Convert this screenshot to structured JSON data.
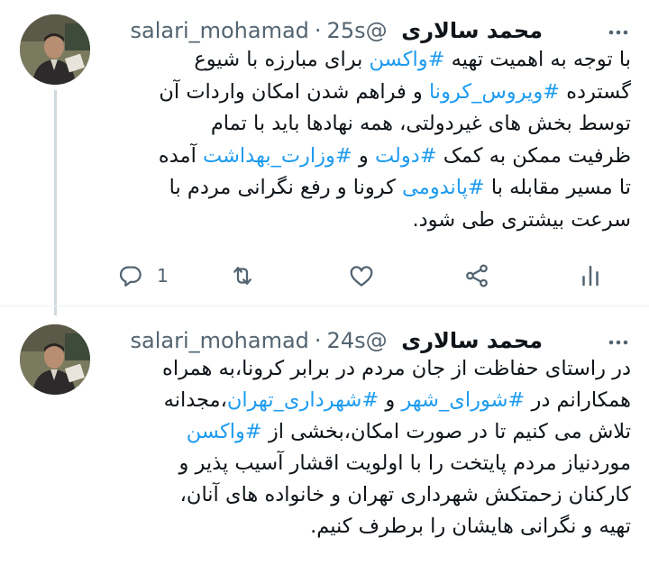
{
  "tweets": [
    {
      "author_name": "محمد سالاری",
      "handle": "@salari_mohamad",
      "separator": "·",
      "time": "25s",
      "lines": [
        [
          {
            "t": "با توجه به اهمیت تهیه "
          },
          {
            "t": "#واکسن",
            "h": true
          },
          {
            "t": " برای مبارزه با شیوع"
          }
        ],
        [
          {
            "t": "گسترده "
          },
          {
            "t": "#ویروس_کرونا",
            "h": true
          },
          {
            "t": " و فراهم شدن امکان واردات آن"
          }
        ],
        [
          {
            "t": "توسط بخش های غیردولتی، همه نهادها باید با تمام"
          }
        ],
        [
          {
            "t": "ظرفیت ممکن به کمک "
          },
          {
            "t": "#دولت",
            "h": true
          },
          {
            "t": " و "
          },
          {
            "t": "#وزارت_بهداشت",
            "h": true
          },
          {
            "t": " آمده"
          }
        ],
        [
          {
            "t": "تا مسیر مقابله با "
          },
          {
            "t": "#پاندومی",
            "h": true
          },
          {
            "t": " کرونا و رفع نگرانی مردم با"
          }
        ],
        [
          {
            "t": "سرعت بیشتری طی شود."
          }
        ]
      ],
      "reply_count": "1"
    },
    {
      "author_name": "محمد سالاری",
      "handle": "@salari_mohamad",
      "separator": "·",
      "time": "24s",
      "lines": [
        [
          {
            "t": "در راستای حفاظت از جان مردم در برابر کرونا،به همراه"
          }
        ],
        [
          {
            "t": "همکارانم در "
          },
          {
            "t": "#شورای_شهر",
            "h": true
          },
          {
            "t": " و "
          },
          {
            "t": "#شهرداری_تهران",
            "h": true
          },
          {
            "t": "،مجدانه"
          }
        ],
        [
          {
            "t": "تلاش می کنیم تا در صورت امکان،بخشی از "
          },
          {
            "t": "#واکسن",
            "h": true
          }
        ],
        [
          {
            "t": "موردنیاز مردم پایتخت را با اولویت اقشار آسیب پذیر و"
          }
        ],
        [
          {
            "t": "کارکنان زحمتکش شهرداری تهران و خانواده های آنان،"
          }
        ],
        [
          {
            "t": "تهیه و نگرانی هایشان را برطرف کنیم."
          }
        ]
      ]
    }
  ],
  "colors": {
    "hashtag": "#1d9bf0",
    "secondary": "#536471",
    "text": "#0f1419"
  },
  "icons": [
    "avatar",
    "more-icon",
    "reply-icon",
    "retweet-icon",
    "like-icon",
    "share-icon",
    "analytics-icon"
  ]
}
